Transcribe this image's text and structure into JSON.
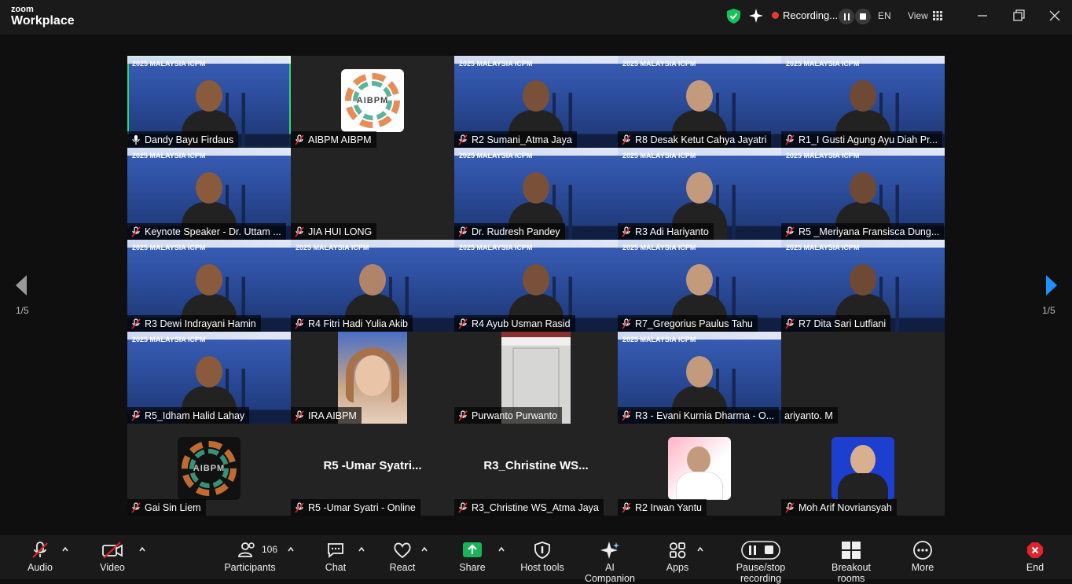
{
  "app": {
    "brand_top": "zoom",
    "brand_bottom": "Workplace"
  },
  "titlebar": {
    "recording_label": "Recording...",
    "language": "EN",
    "view_label": "View"
  },
  "pager": {
    "left": "1/5",
    "right": "1/5"
  },
  "tiles": [
    {
      "name": "Dandy Bayu Firdaus",
      "banner": "2025 MALAYSIA ICPM"
    },
    {
      "name": "AIBPM AIBPM",
      "logo_text": "AIBPM"
    },
    {
      "name": "R2 Sumani_Atma Jaya",
      "banner": "2025 MALAYSIA ICPM"
    },
    {
      "name": "R8 Desak Ketut Cahya Jayatri",
      "banner": "2025 MALAYSIA ICPM"
    },
    {
      "name": "R1_I Gusti Agung Ayu Diah Pr...",
      "banner": "2025 MALAYSIA ICPM"
    },
    {
      "name": "Keynote Speaker - Dr. Uttam ...",
      "banner": "2025 MALAYSIA ICPM"
    },
    {
      "name": "JIA HUI LONG"
    },
    {
      "name": "Dr. Rudresh Pandey",
      "banner": "2025 MALAYSIA ICPM"
    },
    {
      "name": "R3 Adi Hariyanto",
      "banner": "2025 MALAYSIA ICPM"
    },
    {
      "name": "R5 _Meriyana Fransisca Dung...",
      "banner": "2025 MALAYSIA ICPM"
    },
    {
      "name": "R3 Dewi Indrayani Hamin",
      "banner": "2025 MALAYSIA ICPM"
    },
    {
      "name": "R4 Fitri Hadi Yulia Akib",
      "banner": "2025 MALAYSIA ICPM"
    },
    {
      "name": "R4 Ayub Usman Rasid",
      "banner": "2025 MALAYSIA ICPM"
    },
    {
      "name": "R7_Gregorius Paulus Tahu",
      "banner": "2025 MALAYSIA ICPM"
    },
    {
      "name": "R7 Dita Sari Lutfiani",
      "banner": "2025 MALAYSIA ICPM"
    },
    {
      "name": "R5_Idham Halid Lahay",
      "banner": "2025 MALAYSIA ICPM"
    },
    {
      "name": "IRA AIBPM"
    },
    {
      "name": "Purwanto Purwanto"
    },
    {
      "name": "R3 - Evani Kurnia Dharma - O...",
      "banner": "2025 MALAYSIA ICPM"
    },
    {
      "name": "ariyanto. M"
    },
    {
      "name": "Gai Sin Liem",
      "logo_text": "AIBPM"
    },
    {
      "name": "R5 -Umar Syatri - Online",
      "center": "R5 -Umar Syatri..."
    },
    {
      "name": "R3_Christine WS_Atma Jaya",
      "center": "R3_Christine WS..."
    },
    {
      "name": "R2 Irwan Yantu"
    },
    {
      "name": "Moh Arif Novriansyah"
    }
  ],
  "toolbar": {
    "audio": "Audio",
    "video": "Video",
    "participants": "Participants",
    "participant_count": "106",
    "chat": "Chat",
    "react": "React",
    "share": "Share",
    "host_tools": "Host tools",
    "ai_companion": "AI Companion",
    "apps": "Apps",
    "pause_stop": "Pause/stop recording",
    "breakout": "Breakout rooms",
    "more": "More",
    "end": "End"
  },
  "colors": {
    "active_speaker": "#2ed67a",
    "share_green": "#19b35a",
    "end_red": "#e0242b"
  }
}
